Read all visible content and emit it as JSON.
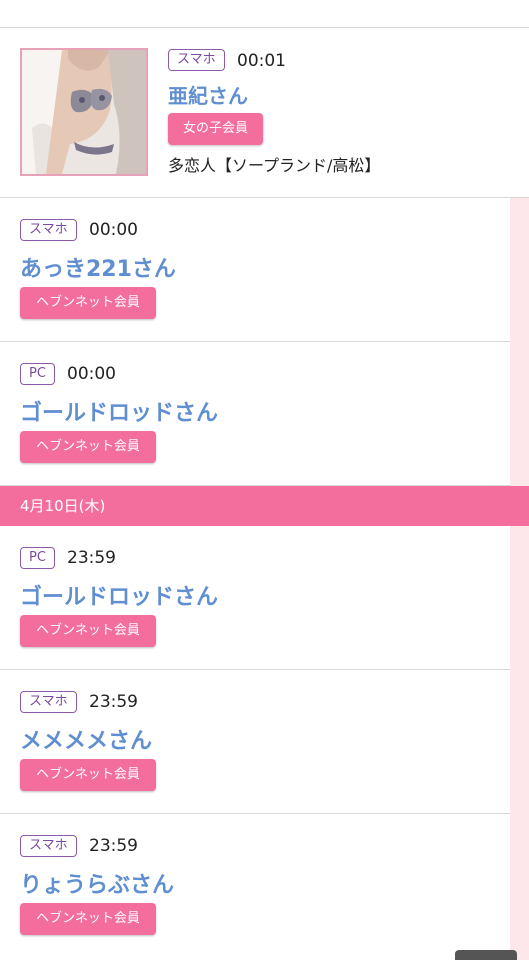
{
  "first_entry": {
    "device": "スマホ",
    "time": "00:01",
    "name": "亜紀さん",
    "member_type": "女の子会員",
    "shop": "多恋人【ソープランド/高松】"
  },
  "entries_top": [
    {
      "device": "スマホ",
      "time": "00:00",
      "name": "あっき221さん",
      "member_type": "ヘブンネット会員"
    },
    {
      "device": "PC",
      "time": "00:00",
      "name": "ゴールドロッドさん",
      "member_type": "ヘブンネット会員"
    }
  ],
  "date_bar": "4月10日(木)",
  "entries_bottom": [
    {
      "device": "PC",
      "time": "23:59",
      "name": "ゴールドロッドさん",
      "member_type": "ヘブンネット会員"
    },
    {
      "device": "スマホ",
      "time": "23:59",
      "name": "メメメメさん",
      "member_type": "ヘブンネット会員"
    },
    {
      "device": "スマホ",
      "time": "23:59",
      "name": "りょうらぶさん",
      "member_type": "ヘブンネット会員"
    }
  ],
  "colors": {
    "accent_pink": "#f36e9c",
    "name_blue": "#5f8ed1",
    "badge_purple": "#7b4aa1",
    "rail_pink": "#fde7eb"
  }
}
